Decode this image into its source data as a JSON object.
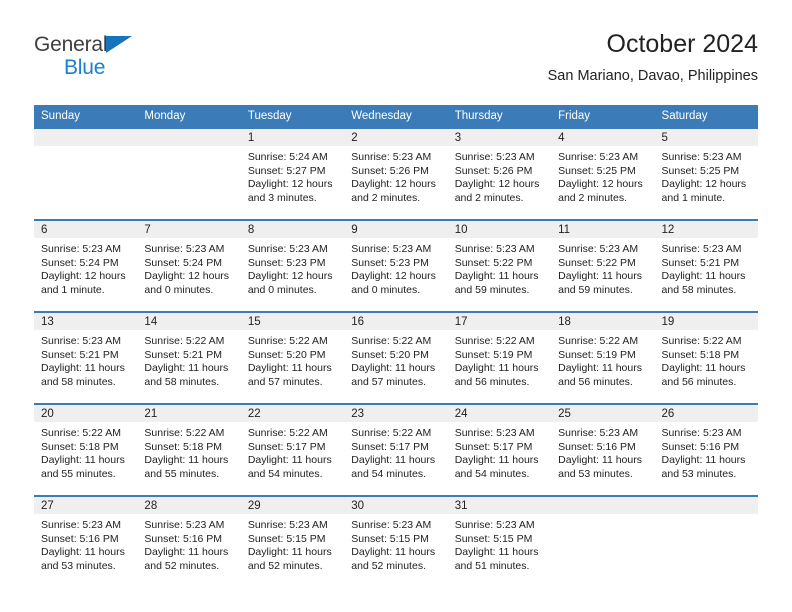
{
  "brand": {
    "name_top": "General",
    "name_bottom": "Blue",
    "triangle_color": "#1673bd",
    "blue_color": "#1b80d0"
  },
  "header": {
    "title": "October 2024",
    "subtitle": "San Mariano, Davao, Philippines"
  },
  "theme": {
    "header_band": "#3b7cb8",
    "daynum_band": "#efefef",
    "text": "#222222"
  },
  "weekday_headers": [
    "Sunday",
    "Monday",
    "Tuesday",
    "Wednesday",
    "Thursday",
    "Friday",
    "Saturday"
  ],
  "weeks": [
    [
      {
        "day": "",
        "sunrise": "",
        "sunset": "",
        "daylight_a": "",
        "daylight_b": ""
      },
      {
        "day": "",
        "sunrise": "",
        "sunset": "",
        "daylight_a": "",
        "daylight_b": ""
      },
      {
        "day": "1",
        "sunrise": "Sunrise: 5:24 AM",
        "sunset": "Sunset: 5:27 PM",
        "daylight_a": "Daylight: 12 hours",
        "daylight_b": "and 3 minutes."
      },
      {
        "day": "2",
        "sunrise": "Sunrise: 5:23 AM",
        "sunset": "Sunset: 5:26 PM",
        "daylight_a": "Daylight: 12 hours",
        "daylight_b": "and 2 minutes."
      },
      {
        "day": "3",
        "sunrise": "Sunrise: 5:23 AM",
        "sunset": "Sunset: 5:26 PM",
        "daylight_a": "Daylight: 12 hours",
        "daylight_b": "and 2 minutes."
      },
      {
        "day": "4",
        "sunrise": "Sunrise: 5:23 AM",
        "sunset": "Sunset: 5:25 PM",
        "daylight_a": "Daylight: 12 hours",
        "daylight_b": "and 2 minutes."
      },
      {
        "day": "5",
        "sunrise": "Sunrise: 5:23 AM",
        "sunset": "Sunset: 5:25 PM",
        "daylight_a": "Daylight: 12 hours",
        "daylight_b": "and 1 minute."
      }
    ],
    [
      {
        "day": "6",
        "sunrise": "Sunrise: 5:23 AM",
        "sunset": "Sunset: 5:24 PM",
        "daylight_a": "Daylight: 12 hours",
        "daylight_b": "and 1 minute."
      },
      {
        "day": "7",
        "sunrise": "Sunrise: 5:23 AM",
        "sunset": "Sunset: 5:24 PM",
        "daylight_a": "Daylight: 12 hours",
        "daylight_b": "and 0 minutes."
      },
      {
        "day": "8",
        "sunrise": "Sunrise: 5:23 AM",
        "sunset": "Sunset: 5:23 PM",
        "daylight_a": "Daylight: 12 hours",
        "daylight_b": "and 0 minutes."
      },
      {
        "day": "9",
        "sunrise": "Sunrise: 5:23 AM",
        "sunset": "Sunset: 5:23 PM",
        "daylight_a": "Daylight: 12 hours",
        "daylight_b": "and 0 minutes."
      },
      {
        "day": "10",
        "sunrise": "Sunrise: 5:23 AM",
        "sunset": "Sunset: 5:22 PM",
        "daylight_a": "Daylight: 11 hours",
        "daylight_b": "and 59 minutes."
      },
      {
        "day": "11",
        "sunrise": "Sunrise: 5:23 AM",
        "sunset": "Sunset: 5:22 PM",
        "daylight_a": "Daylight: 11 hours",
        "daylight_b": "and 59 minutes."
      },
      {
        "day": "12",
        "sunrise": "Sunrise: 5:23 AM",
        "sunset": "Sunset: 5:21 PM",
        "daylight_a": "Daylight: 11 hours",
        "daylight_b": "and 58 minutes."
      }
    ],
    [
      {
        "day": "13",
        "sunrise": "Sunrise: 5:23 AM",
        "sunset": "Sunset: 5:21 PM",
        "daylight_a": "Daylight: 11 hours",
        "daylight_b": "and 58 minutes."
      },
      {
        "day": "14",
        "sunrise": "Sunrise: 5:22 AM",
        "sunset": "Sunset: 5:21 PM",
        "daylight_a": "Daylight: 11 hours",
        "daylight_b": "and 58 minutes."
      },
      {
        "day": "15",
        "sunrise": "Sunrise: 5:22 AM",
        "sunset": "Sunset: 5:20 PM",
        "daylight_a": "Daylight: 11 hours",
        "daylight_b": "and 57 minutes."
      },
      {
        "day": "16",
        "sunrise": "Sunrise: 5:22 AM",
        "sunset": "Sunset: 5:20 PM",
        "daylight_a": "Daylight: 11 hours",
        "daylight_b": "and 57 minutes."
      },
      {
        "day": "17",
        "sunrise": "Sunrise: 5:22 AM",
        "sunset": "Sunset: 5:19 PM",
        "daylight_a": "Daylight: 11 hours",
        "daylight_b": "and 56 minutes."
      },
      {
        "day": "18",
        "sunrise": "Sunrise: 5:22 AM",
        "sunset": "Sunset: 5:19 PM",
        "daylight_a": "Daylight: 11 hours",
        "daylight_b": "and 56 minutes."
      },
      {
        "day": "19",
        "sunrise": "Sunrise: 5:22 AM",
        "sunset": "Sunset: 5:18 PM",
        "daylight_a": "Daylight: 11 hours",
        "daylight_b": "and 56 minutes."
      }
    ],
    [
      {
        "day": "20",
        "sunrise": "Sunrise: 5:22 AM",
        "sunset": "Sunset: 5:18 PM",
        "daylight_a": "Daylight: 11 hours",
        "daylight_b": "and 55 minutes."
      },
      {
        "day": "21",
        "sunrise": "Sunrise: 5:22 AM",
        "sunset": "Sunset: 5:18 PM",
        "daylight_a": "Daylight: 11 hours",
        "daylight_b": "and 55 minutes."
      },
      {
        "day": "22",
        "sunrise": "Sunrise: 5:22 AM",
        "sunset": "Sunset: 5:17 PM",
        "daylight_a": "Daylight: 11 hours",
        "daylight_b": "and 54 minutes."
      },
      {
        "day": "23",
        "sunrise": "Sunrise: 5:22 AM",
        "sunset": "Sunset: 5:17 PM",
        "daylight_a": "Daylight: 11 hours",
        "daylight_b": "and 54 minutes."
      },
      {
        "day": "24",
        "sunrise": "Sunrise: 5:23 AM",
        "sunset": "Sunset: 5:17 PM",
        "daylight_a": "Daylight: 11 hours",
        "daylight_b": "and 54 minutes."
      },
      {
        "day": "25",
        "sunrise": "Sunrise: 5:23 AM",
        "sunset": "Sunset: 5:16 PM",
        "daylight_a": "Daylight: 11 hours",
        "daylight_b": "and 53 minutes."
      },
      {
        "day": "26",
        "sunrise": "Sunrise: 5:23 AM",
        "sunset": "Sunset: 5:16 PM",
        "daylight_a": "Daylight: 11 hours",
        "daylight_b": "and 53 minutes."
      }
    ],
    [
      {
        "day": "27",
        "sunrise": "Sunrise: 5:23 AM",
        "sunset": "Sunset: 5:16 PM",
        "daylight_a": "Daylight: 11 hours",
        "daylight_b": "and 53 minutes."
      },
      {
        "day": "28",
        "sunrise": "Sunrise: 5:23 AM",
        "sunset": "Sunset: 5:16 PM",
        "daylight_a": "Daylight: 11 hours",
        "daylight_b": "and 52 minutes."
      },
      {
        "day": "29",
        "sunrise": "Sunrise: 5:23 AM",
        "sunset": "Sunset: 5:15 PM",
        "daylight_a": "Daylight: 11 hours",
        "daylight_b": "and 52 minutes."
      },
      {
        "day": "30",
        "sunrise": "Sunrise: 5:23 AM",
        "sunset": "Sunset: 5:15 PM",
        "daylight_a": "Daylight: 11 hours",
        "daylight_b": "and 52 minutes."
      },
      {
        "day": "31",
        "sunrise": "Sunrise: 5:23 AM",
        "sunset": "Sunset: 5:15 PM",
        "daylight_a": "Daylight: 11 hours",
        "daylight_b": "and 51 minutes."
      },
      {
        "day": "",
        "sunrise": "",
        "sunset": "",
        "daylight_a": "",
        "daylight_b": ""
      },
      {
        "day": "",
        "sunrise": "",
        "sunset": "",
        "daylight_a": "",
        "daylight_b": ""
      }
    ]
  ]
}
